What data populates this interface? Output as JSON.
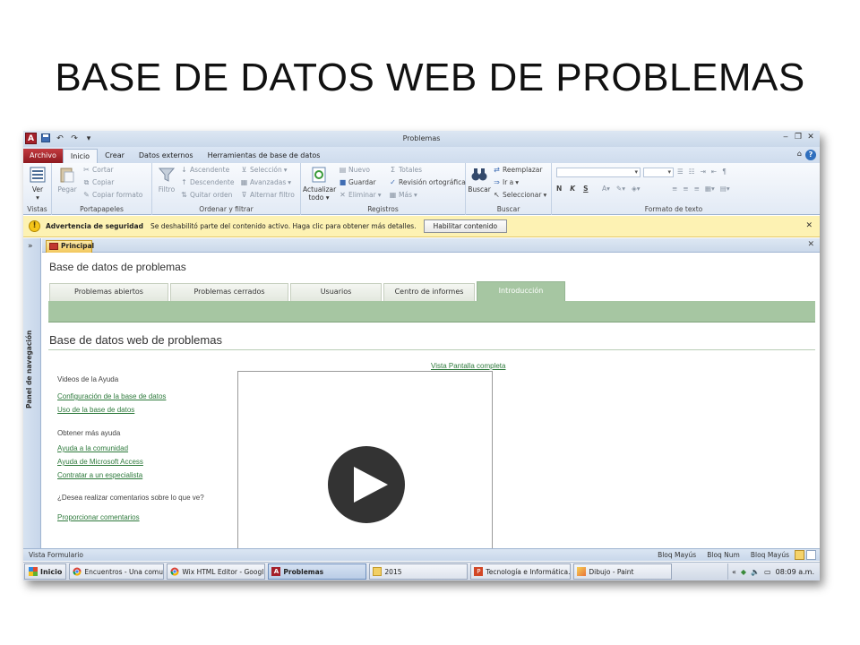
{
  "slide": {
    "title": "BASE DE DATOS WEB DE PROBLEMAS"
  },
  "window": {
    "title": "Problemas",
    "app_icon": "A"
  },
  "ribbon_tabs": [
    "Archivo",
    "Inicio",
    "Crear",
    "Datos externos",
    "Herramientas de base de datos"
  ],
  "ribbon": {
    "vistas": {
      "label": "Vistas",
      "ver": "Ver"
    },
    "portapapeles": {
      "label": "Portapapeles",
      "pegar": "Pegar",
      "cortar": "Cortar",
      "copiar": "Copiar",
      "copiar_formato": "Copiar formato"
    },
    "ordenar": {
      "label": "Ordenar y filtrar",
      "filtro": "Filtro",
      "ascendente": "Ascendente",
      "descendente": "Descendente",
      "quitar_orden": "Quitar orden",
      "seleccion": "Selección",
      "avanzadas": "Avanzadas",
      "alternar_filtro": "Alternar filtro"
    },
    "registros": {
      "label": "Registros",
      "actualizar": "Actualizar",
      "todo": "todo",
      "nuevo": "Nuevo",
      "guardar": "Guardar",
      "eliminar": "Eliminar",
      "totales": "Totales",
      "revision": "Revisión ortográfica",
      "mas": "Más"
    },
    "buscar": {
      "label": "Buscar",
      "buscar": "Buscar",
      "reemplazar": "Reemplazar",
      "ir_a": "Ir a",
      "seleccionar": "Seleccionar"
    },
    "formato": {
      "label": "Formato de texto",
      "bold": "N",
      "italic": "K",
      "underline": "S"
    }
  },
  "security_bar": {
    "title": "Advertencia de seguridad",
    "message": "Se deshabilitó parte del contenido activo. Haga clic para obtener más detalles.",
    "button": "Habilitar contenido"
  },
  "nav_pane": {
    "toggle": "»",
    "label": "Panel de navegación"
  },
  "document_tab": {
    "label": "Principal"
  },
  "form": {
    "title": "Base de datos de problemas",
    "tabs": [
      "Problemas abiertos",
      "Problemas cerrados",
      "Usuarios",
      "Centro de informes",
      "Introducción"
    ],
    "active_tab": "Introducción",
    "subtitle": "Base de datos web de problemas",
    "help_videos_heading": "Videos de la Ayuda",
    "help_video_links": [
      "Configuración de la base de datos",
      "Uso de la base de datos"
    ],
    "more_help_heading": "Obtener más ayuda",
    "more_help_links": [
      "Ayuda a la comunidad",
      "Ayuda de Microsoft Access",
      "Contratar a un especialista"
    ],
    "feedback_question": "¿Desea realizar comentarios sobre lo que ve?",
    "feedback_link": "Proporcionar comentarios",
    "fullscreen_link": "Vista Pantalla completa"
  },
  "status_bar": {
    "left": "Vista Formulario",
    "indicators": [
      "Bloq Mayús",
      "Bloq Num",
      "Bloq Mayús"
    ]
  },
  "taskbar": {
    "start": "Inicio",
    "items": [
      {
        "label": "Encuentros - Una comuni...",
        "icon": "chrome-icon"
      },
      {
        "label": "Wix HTML Editor - Googl...",
        "icon": "chrome-icon"
      },
      {
        "label": "Problemas",
        "icon": "access-icon",
        "active": true
      },
      {
        "label": "2015",
        "icon": "folder-icon"
      },
      {
        "label": "Tecnología e Informática...",
        "icon": "powerpoint-icon"
      },
      {
        "label": "Dibujo - Paint",
        "icon": "paint-icon"
      }
    ],
    "tray_chevron": "«",
    "clock": "08:09 a.m."
  },
  "colors": {
    "access_red": "#a4202a",
    "form_accent": "#a6c6a2",
    "link": "#2e7a3c",
    "security_bar": "#fdf2b3"
  }
}
